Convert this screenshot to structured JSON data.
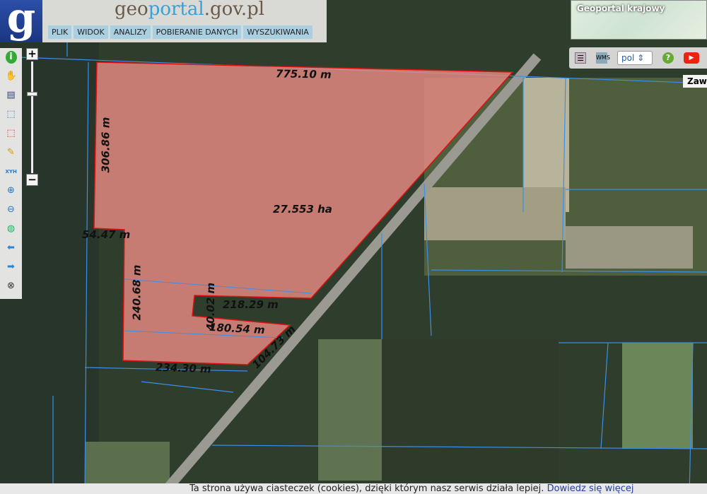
{
  "header": {
    "logo_letter": "g",
    "brand_pre": "geo",
    "brand_accent": "portal",
    "brand_post": ".gov.pl",
    "menu": [
      "PLIK",
      "WIDOK",
      "ANALIZY",
      "POBIERANIE DANYCH",
      "WYSZUKIWANIA"
    ]
  },
  "minimap": {
    "title": "Geoportal krajowy"
  },
  "toolbar_right": {
    "language": "pol",
    "icons": [
      "legend-icon",
      "wms-icon",
      "help-icon",
      "youtube-icon"
    ]
  },
  "place_label": "Zaw",
  "left_toolbar": [
    "info-icon",
    "pan-hand-icon",
    "layers-list-icon",
    "select-icon",
    "select-area-icon",
    "pencil-icon",
    "xyh-icon",
    "zoom-in-icon",
    "zoom-out-icon",
    "globe-icon",
    "back-arrow-icon",
    "forward-arrow-icon",
    "clear-icon"
  ],
  "zoom": {
    "plus": "+",
    "minus": "−",
    "level_fraction": 0.4
  },
  "parcel": {
    "area": "27.553 ha",
    "fill": "#e88a82",
    "stroke": "#e01010",
    "measurements": [
      "775.10 m",
      "306.86 m",
      "54.47 m",
      "240.68 m",
      "40.02 m",
      "218.29 m",
      "180.54 m",
      "104.73 m",
      "234.30 m"
    ]
  },
  "cookie": {
    "text": "Ta strona używa ciasteczek (cookies), dzięki którym nasz serwis działa lepiej.",
    "link": "Dowiedz się więcej"
  },
  "colors": {
    "parcel_line": "#3b8fe8",
    "road": "#9a9a92"
  }
}
